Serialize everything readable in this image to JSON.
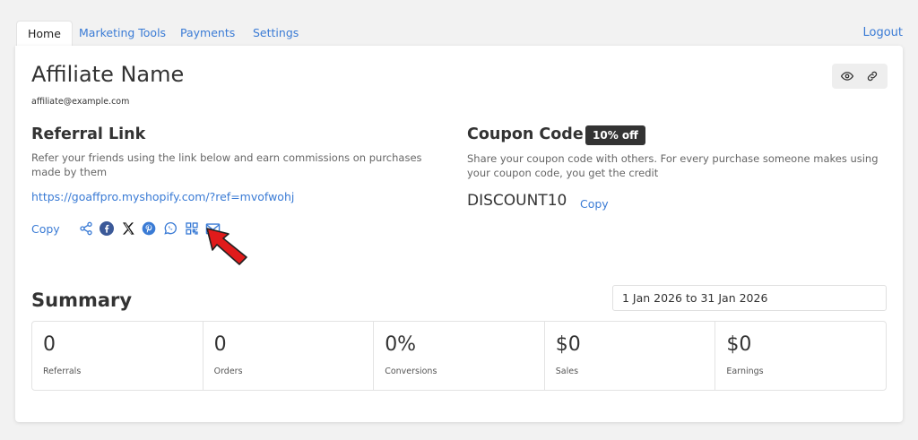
{
  "tabs": {
    "home": "Home",
    "marketing_tools": "Marketing Tools",
    "payments": "Payments",
    "settings": "Settings",
    "logout": "Logout"
  },
  "affiliate": {
    "name": "Affiliate Name",
    "email": "affiliate@example.com"
  },
  "header_icons": [
    "eye-icon",
    "link-icon"
  ],
  "referral": {
    "title": "Referral Link",
    "description": "Refer your friends using the link below and earn commissions on purchases made by them",
    "link": "https://goaffpro.myshopify.com/?ref=mvofwohj",
    "copy_label": "Copy",
    "share_icons": [
      "share-icon",
      "facebook-icon",
      "x-icon",
      "pinterest-icon",
      "whatsapp-icon",
      "qr-code-icon",
      "email-icon"
    ]
  },
  "coupon": {
    "title": "Coupon Code",
    "badge": "10% off",
    "description": "Share your coupon code with others. For every purchase someone makes using your coupon code, you get the credit",
    "code": "DISCOUNT10",
    "copy_label": "Copy"
  },
  "summary": {
    "title": "Summary",
    "date_range": "1 Jan 2026 to 31 Jan 2026",
    "stats": [
      {
        "value": "0",
        "label": "Referrals"
      },
      {
        "value": "0",
        "label": "Orders"
      },
      {
        "value": "0%",
        "label": "Conversions"
      },
      {
        "value": "$0",
        "label": "Sales"
      },
      {
        "value": "$0",
        "label": "Earnings"
      }
    ]
  },
  "colors": {
    "link": "#3a7bd5",
    "badge_bg": "#333333",
    "arrow": "#e01b1b",
    "facebook": "#3b5998",
    "background": "#f2f2f2"
  }
}
